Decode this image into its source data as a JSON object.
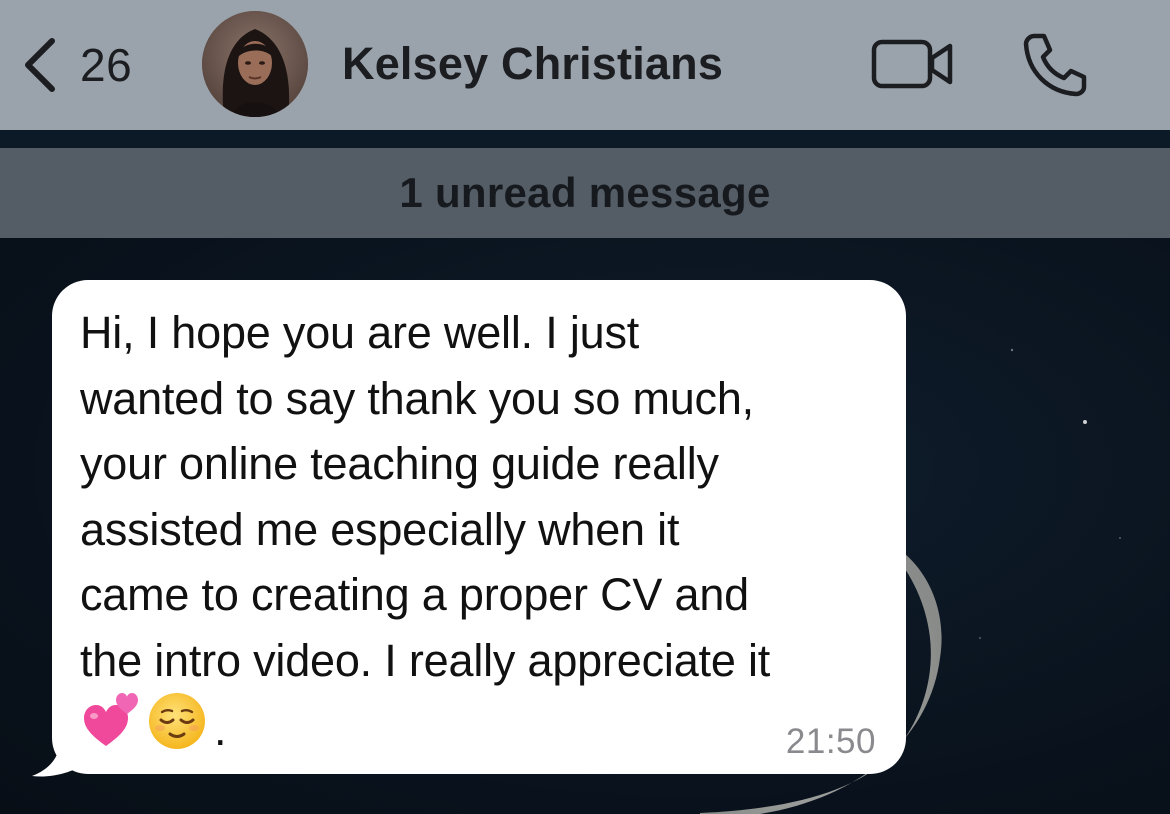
{
  "header": {
    "back_count": "26",
    "contact_name": "Kelsey Christians"
  },
  "banner": {
    "unread_label": "1 unread message"
  },
  "message": {
    "text": "Hi, I hope you are well. I just\nwanted to say thank you so much,\nyour online teaching guide really\nassisted me especially when it\ncame to creating a proper CV and\nthe intro video. I really appreciate it",
    "emoji_trail": ".",
    "time": "21:50",
    "emojis": [
      "two-hearts-icon",
      "relieved-face-icon"
    ]
  },
  "colors": {
    "header_bg": "#9aa3ab",
    "banner_bg": "#545d66",
    "bubble_bg": "#ffffff",
    "timestamp": "#8a8a8e"
  }
}
